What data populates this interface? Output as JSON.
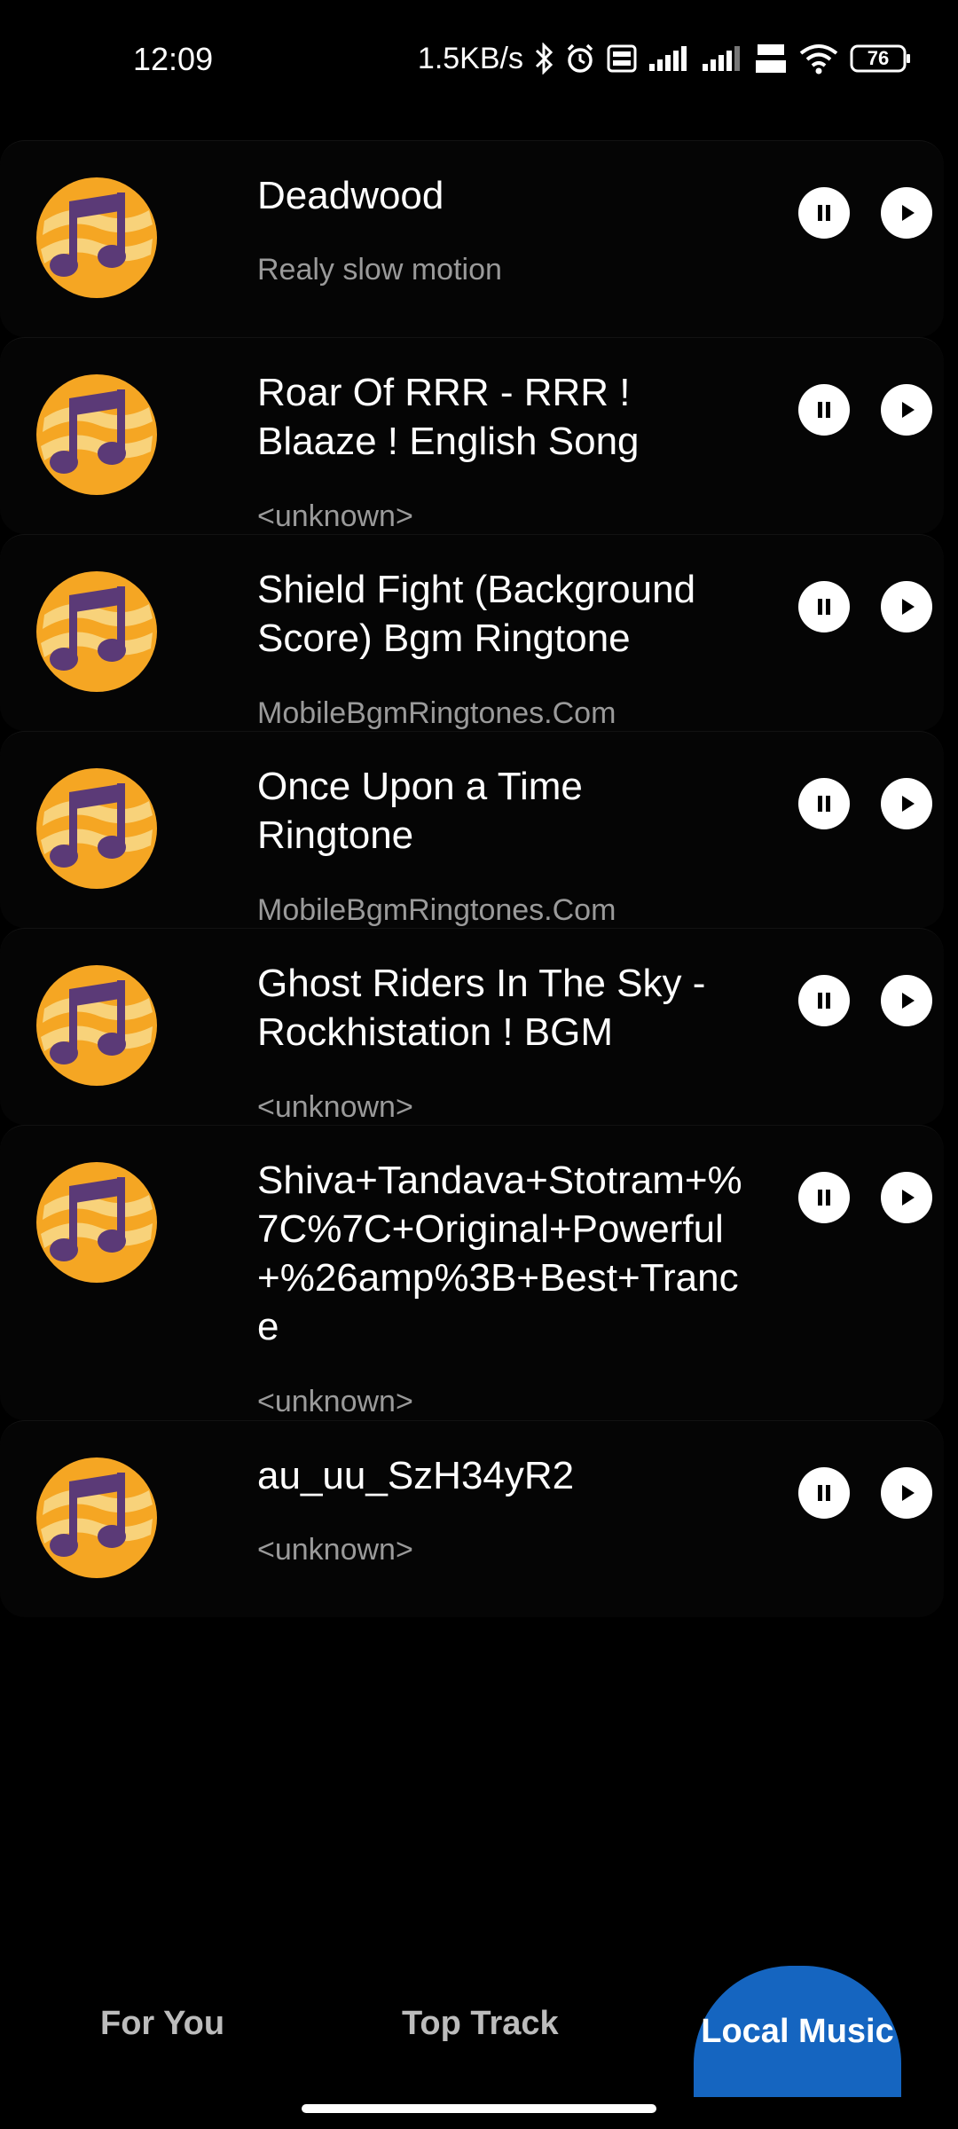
{
  "status_bar": {
    "time": "12:09",
    "speed": "1.5KB/s",
    "battery": "76"
  },
  "tracks": [
    {
      "title": "Deadwood",
      "artist": "Realy slow motion"
    },
    {
      "title": "Roar Of RRR - RRR ! Blaaze ! English Song",
      "artist": "<unknown>"
    },
    {
      "title": "Shield Fight (Background Score) Bgm Ringtone",
      "artist": "MobileBgmRingtones.Com"
    },
    {
      "title": "Once Upon a Time Ringtone",
      "artist": "MobileBgmRingtones.Com"
    },
    {
      "title": "Ghost Riders In The Sky - Rockhistation ! BGM",
      "artist": "<unknown>"
    },
    {
      "title": "Shiva+Tandava+Stotram+%7C%7C+Original+Powerful+%26amp%3B+Best+Trance",
      "artist": "<unknown>"
    },
    {
      "title": "au_uu_SzH34yR2",
      "artist": "<unknown>"
    }
  ],
  "bottom_nav": {
    "for_you": "For You",
    "top_track": "Top Track",
    "local_music": "Local Music"
  },
  "colors": {
    "accent": "#1565c0",
    "icon_orange": "#f5a623",
    "icon_purple": "#5b3a77",
    "icon_stripe": "#f8d27a"
  }
}
